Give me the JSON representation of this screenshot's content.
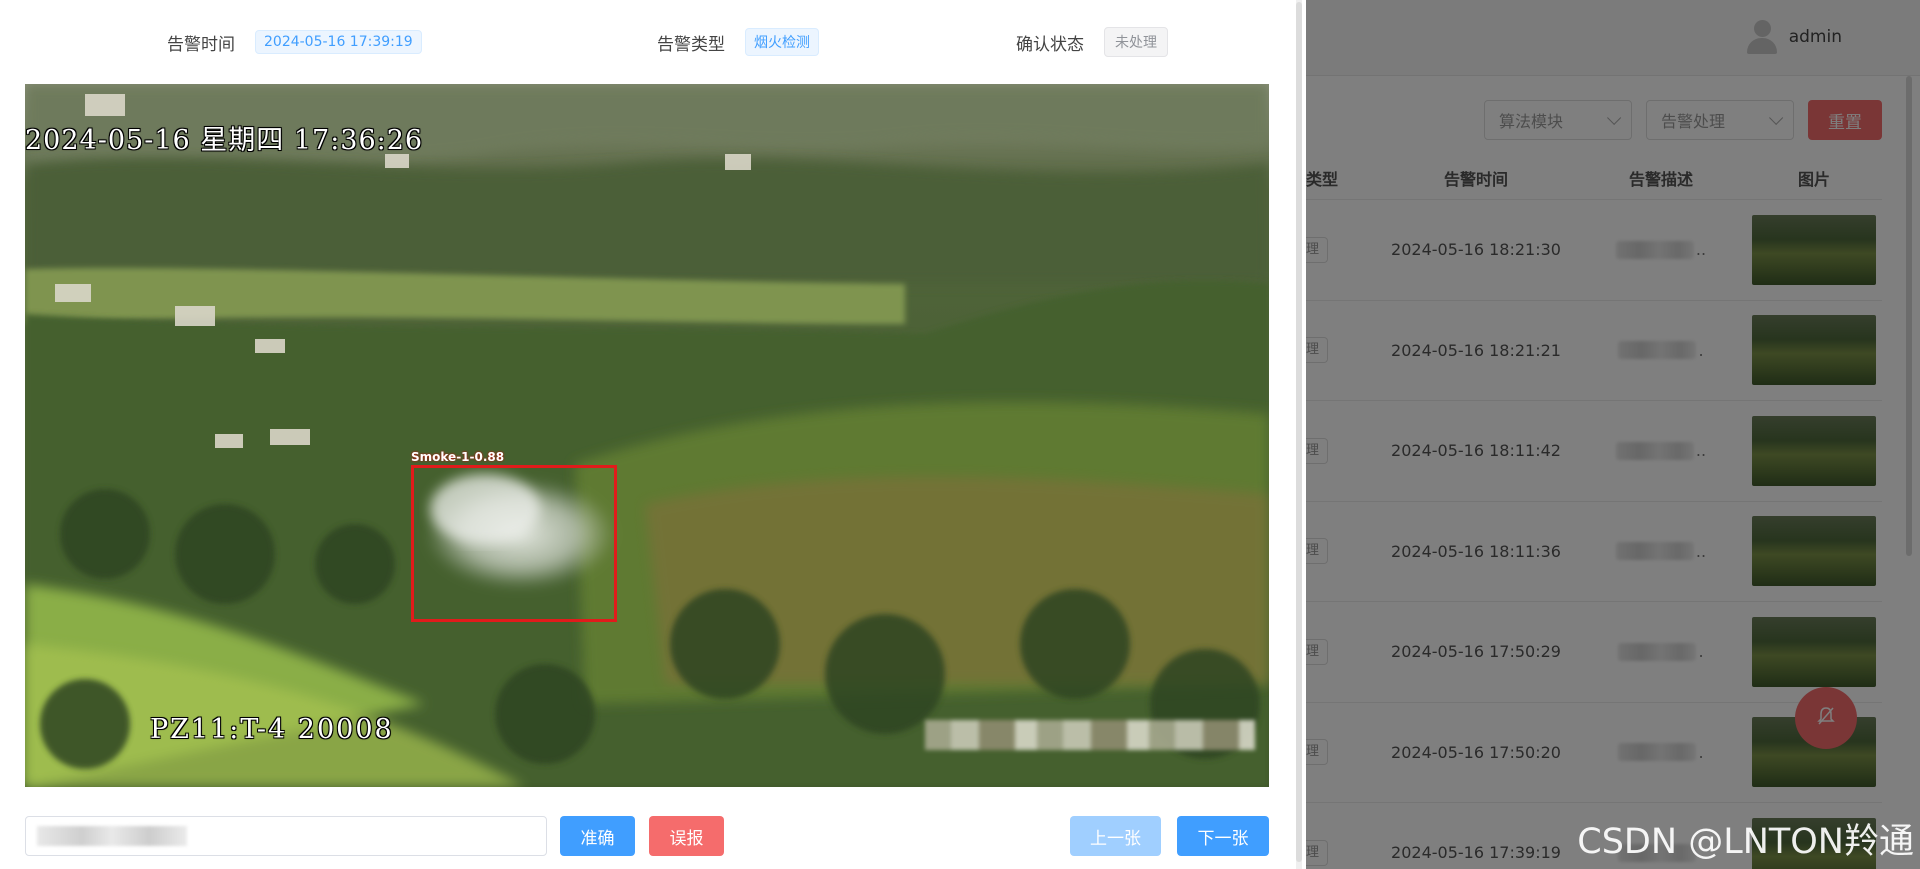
{
  "header": {
    "username": "admin"
  },
  "filters": {
    "algorithm_placeholder": "算法模块",
    "handling_placeholder": "告警处理",
    "reset_label": "重置"
  },
  "table": {
    "headers": {
      "type": "类型",
      "time": "告警时间",
      "desc": "告警描述",
      "image": "图片"
    },
    "type_tag": "理",
    "rows": [
      {
        "time": "2024-05-16 18:21:30",
        "ellipsis": ".."
      },
      {
        "time": "2024-05-16 18:21:21",
        "ellipsis": "."
      },
      {
        "time": "2024-05-16 18:11:42",
        "ellipsis": ".."
      },
      {
        "time": "2024-05-16 18:11:36",
        "ellipsis": ".."
      },
      {
        "time": "2024-05-16 17:50:29",
        "ellipsis": "."
      },
      {
        "time": "2024-05-16 17:50:20",
        "ellipsis": "."
      },
      {
        "time": "2024-05-16 17:39:19",
        "ellipsis": "."
      }
    ]
  },
  "drawer": {
    "alarm_time_label": "告警时间",
    "alarm_time_value": "2024-05-16 17:39:19",
    "alarm_type_label": "告警类型",
    "alarm_type_value": "烟火检测",
    "confirm_label": "确认状态",
    "confirm_value": "未处理",
    "image": {
      "osd_datetime": "2024-05-16 星期四 17:36:26",
      "osd_camera": "PZ11:T-4   20008",
      "detection_label": "Smoke-1-0.88"
    },
    "buttons": {
      "accurate": "准确",
      "false_alarm": "误报",
      "prev": "上一张",
      "next": "下一张"
    }
  },
  "float_button_icon": "bell-off-icon",
  "watermark": "CSDN @LNTON羚通",
  "colors": {
    "primary": "#409eff",
    "danger": "#f56c6c",
    "primary_light": "#a0cfff",
    "detection_box": "#e11b1b"
  }
}
